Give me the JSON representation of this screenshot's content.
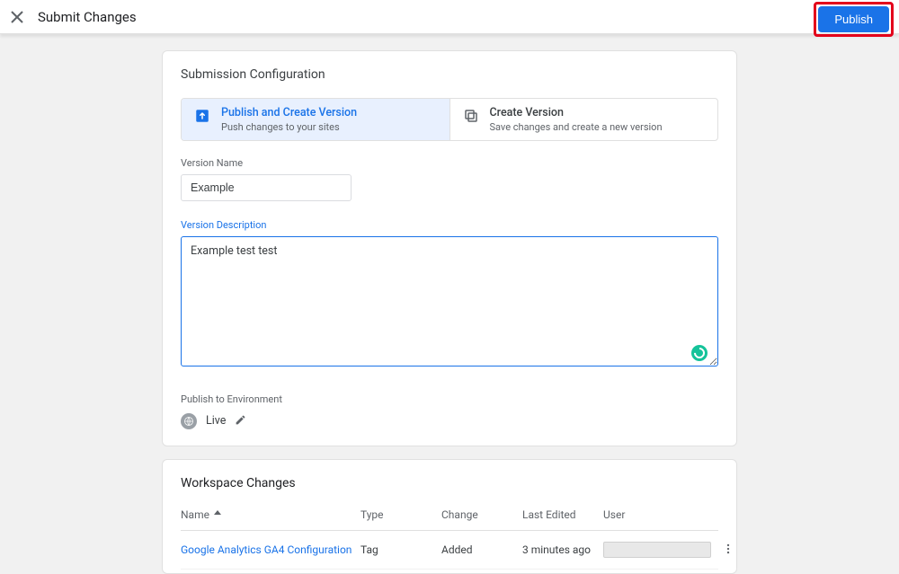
{
  "header": {
    "title": "Submit Changes",
    "publish_label": "Publish"
  },
  "config": {
    "section_title": "Submission Configuration",
    "tabs": [
      {
        "title": "Publish and Create Version",
        "subtitle": "Push changes to your sites"
      },
      {
        "title": "Create Version",
        "subtitle": "Save changes and create a new version"
      }
    ],
    "version_name_label": "Version Name",
    "version_name_value": "Example",
    "version_desc_label": "Version Description",
    "version_desc_value": "Example test test",
    "env_label": "Publish to Environment",
    "env_value": "Live"
  },
  "workspace": {
    "title": "Workspace Changes",
    "columns": {
      "name": "Name",
      "type": "Type",
      "change": "Change",
      "edited": "Last Edited",
      "user": "User"
    },
    "rows": [
      {
        "name": "Google Analytics GA4 Configuration",
        "type": "Tag",
        "change": "Added",
        "edited": "3 minutes ago"
      }
    ]
  }
}
